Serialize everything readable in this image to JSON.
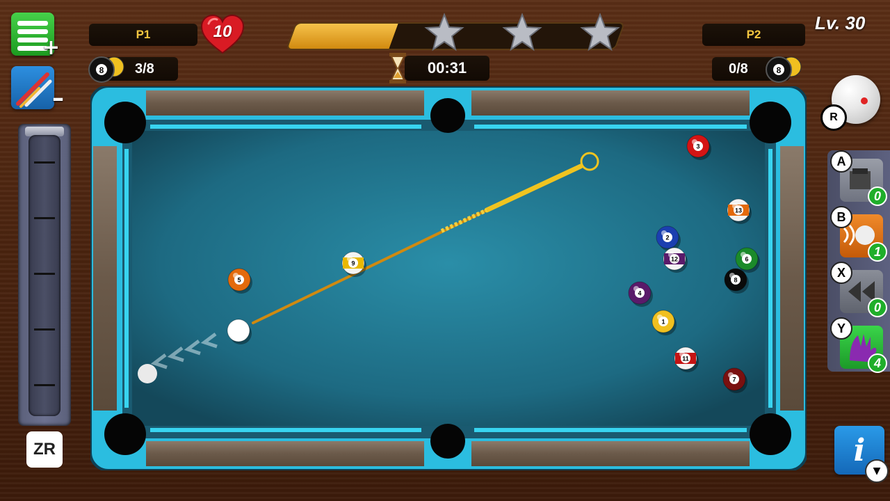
{
  "hud": {
    "player1": "P1",
    "player2": "P2",
    "heart_value": "10",
    "level": "Lv. 30",
    "timer": "00:31",
    "p1_balls": "3/8",
    "p2_balls": "0/8",
    "progress_fraction": 0.31,
    "stars": 3
  },
  "controls": {
    "zr_label": "ZR",
    "reset_label": "R",
    "info_label": "i",
    "down_label": "▼"
  },
  "items": [
    {
      "key": "A",
      "count": "0",
      "icon": "chalk-icon"
    },
    {
      "key": "B",
      "count": "1",
      "icon": "power-shot-icon"
    },
    {
      "key": "X",
      "count": "0",
      "icon": "rewind-icon"
    },
    {
      "key": "Y",
      "count": "4",
      "icon": "ball-in-hand-icon"
    }
  ],
  "balls": [
    {
      "number": "",
      "color": "#ffffff",
      "kind": "cue"
    },
    {
      "number": "9",
      "color": "#e8b800",
      "kind": "stripe"
    },
    {
      "number": "5",
      "color": "#e36a0c",
      "kind": "solid"
    },
    {
      "number": "3",
      "color": "#d41414",
      "kind": "solid"
    },
    {
      "number": "13",
      "color": "#e36a0c",
      "kind": "stripe"
    },
    {
      "number": "2",
      "color": "#1b3fb0",
      "kind": "solid"
    },
    {
      "number": "12",
      "color": "#5a1a6a",
      "kind": "stripe"
    },
    {
      "number": "6",
      "color": "#1b8a2a",
      "kind": "solid"
    },
    {
      "number": "8",
      "color": "#0a0a0a",
      "kind": "solid"
    },
    {
      "number": "4",
      "color": "#5a1a6a",
      "kind": "solid"
    },
    {
      "number": "1",
      "color": "#f0c020",
      "kind": "solid"
    },
    {
      "number": "11",
      "color": "#c41414",
      "kind": "stripe"
    },
    {
      "number": "7",
      "color": "#7a1010",
      "kind": "solid"
    }
  ]
}
